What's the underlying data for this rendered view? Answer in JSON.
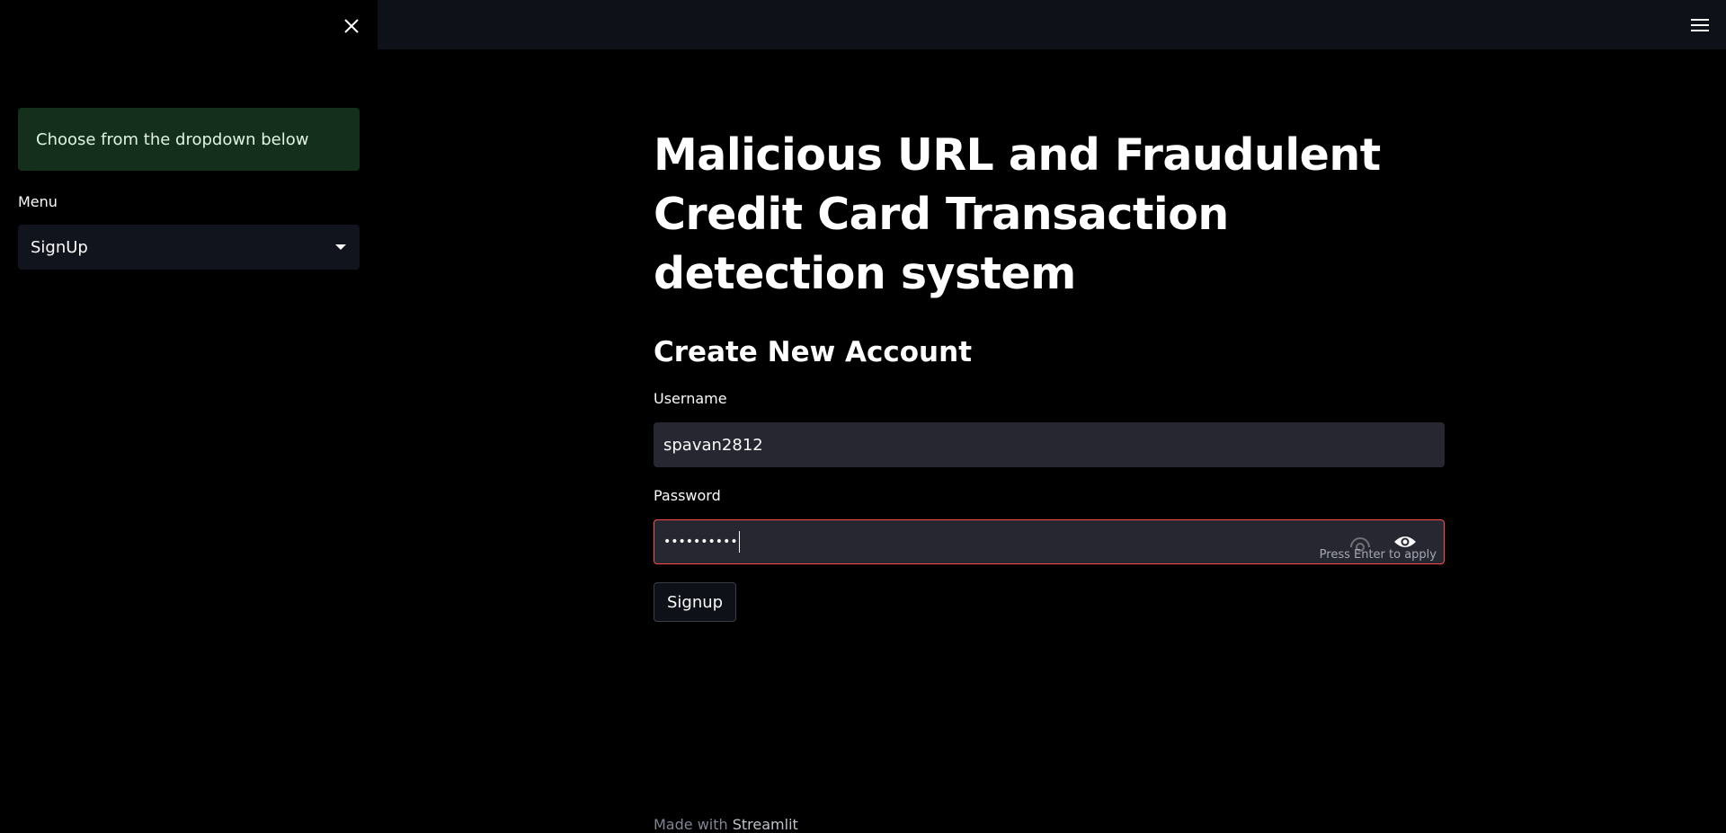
{
  "sidebar": {
    "info_text": "Choose from the dropdown below",
    "menu_label": "Menu",
    "menu_selected": "SignUp"
  },
  "main": {
    "title": "Malicious URL and Fraudulent Credit Card Transaction detection system",
    "subtitle": "Create New Account",
    "username_label": "Username",
    "username_value": "spavan2812",
    "password_label": "Password",
    "password_masked": "••••••••••",
    "password_hint": "Press Enter to apply",
    "signup_label": "Signup"
  },
  "footer": {
    "made_with": "Made with",
    "brand": "Streamlit"
  },
  "colors": {
    "background": "#000000",
    "topbar": "#0e1117",
    "info_bg": "#14301c",
    "input_bg": "#262730",
    "error_border": "#ff4b4b"
  }
}
